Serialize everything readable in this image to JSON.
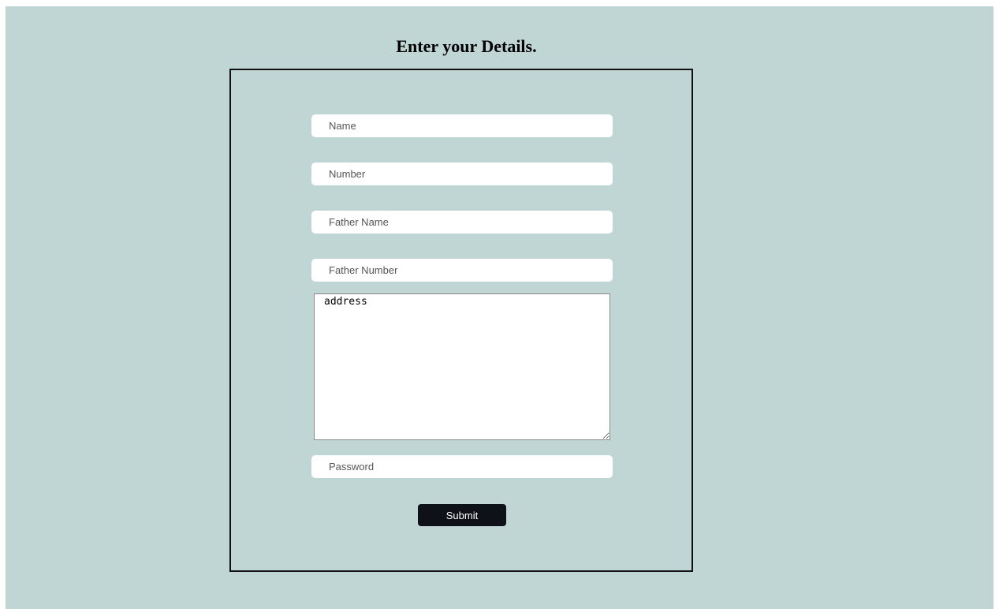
{
  "page": {
    "title": "Enter your Details."
  },
  "form": {
    "name_placeholder": "Name",
    "number_placeholder": "Number",
    "father_name_placeholder": "Father Name",
    "father_number_placeholder": "Father Number",
    "address_placeholder": "address",
    "password_placeholder": "Password",
    "submit_label": "Submit"
  },
  "colors": {
    "background": "#bfd6d4",
    "button": "#0e1117",
    "border": "#111111"
  }
}
